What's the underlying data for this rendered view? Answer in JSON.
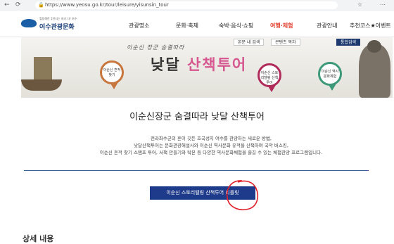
{
  "browser": {
    "back": "←",
    "reload": "⟳",
    "url": "https://www.yeosu.go.kr/tour/leisure/yisunsin_tour",
    "icons": [
      "star-icon",
      "menu-icon"
    ]
  },
  "header": {
    "logo_small": "힐링해란 1번지는 여기 다! 여수",
    "logo_main": "여수관광문화",
    "nav": [
      "관광명소",
      "문화·축제",
      "숙박·음식·쇼핑",
      "여행·체험",
      "관광안내",
      "추천코스★이벤트"
    ],
    "active_index": 3
  },
  "banner": {
    "buttons": [
      "본문 내 검색",
      "콘텐츠 목차",
      "통합검색"
    ],
    "subtitle": "이순신 장군 숨결따라",
    "title_part1": "낮달 ",
    "title_part2": "산책투어",
    "pins": [
      "이순신 흔적찾기",
      "이순신 스토리텔링 산책투어",
      "이순신 역사문화체험"
    ],
    "pin_colors": [
      "#c7763d",
      "#b02a5a",
      "#3c9a7a"
    ]
  },
  "content": {
    "title": "이순신장군 숨결따라 낮달 산책투어",
    "desc_line1": "전라좌수군의 혼이 깃든 호국성지 여수를 관광하는 새로운 방법,",
    "desc_line2": "낮달산책투어는 문화관광해설사와 이순신 역사문화 유적을 산책하며 국악 버스킹,",
    "desc_line3": "이순신 흔적 찾기 스탬프 투어, 서책 만들기와 탁본 등 다양한 역사문화체험을 즐길 수 있는 체험관광 프로그램입니다.",
    "cta_label": "이순신 스토리텔링 산책투어 리플릿",
    "next_heading": "상세 내용"
  },
  "colors": {
    "accent": "#1e3a8a",
    "active_nav": "#e23f2e",
    "annotation": "#e0202a"
  }
}
